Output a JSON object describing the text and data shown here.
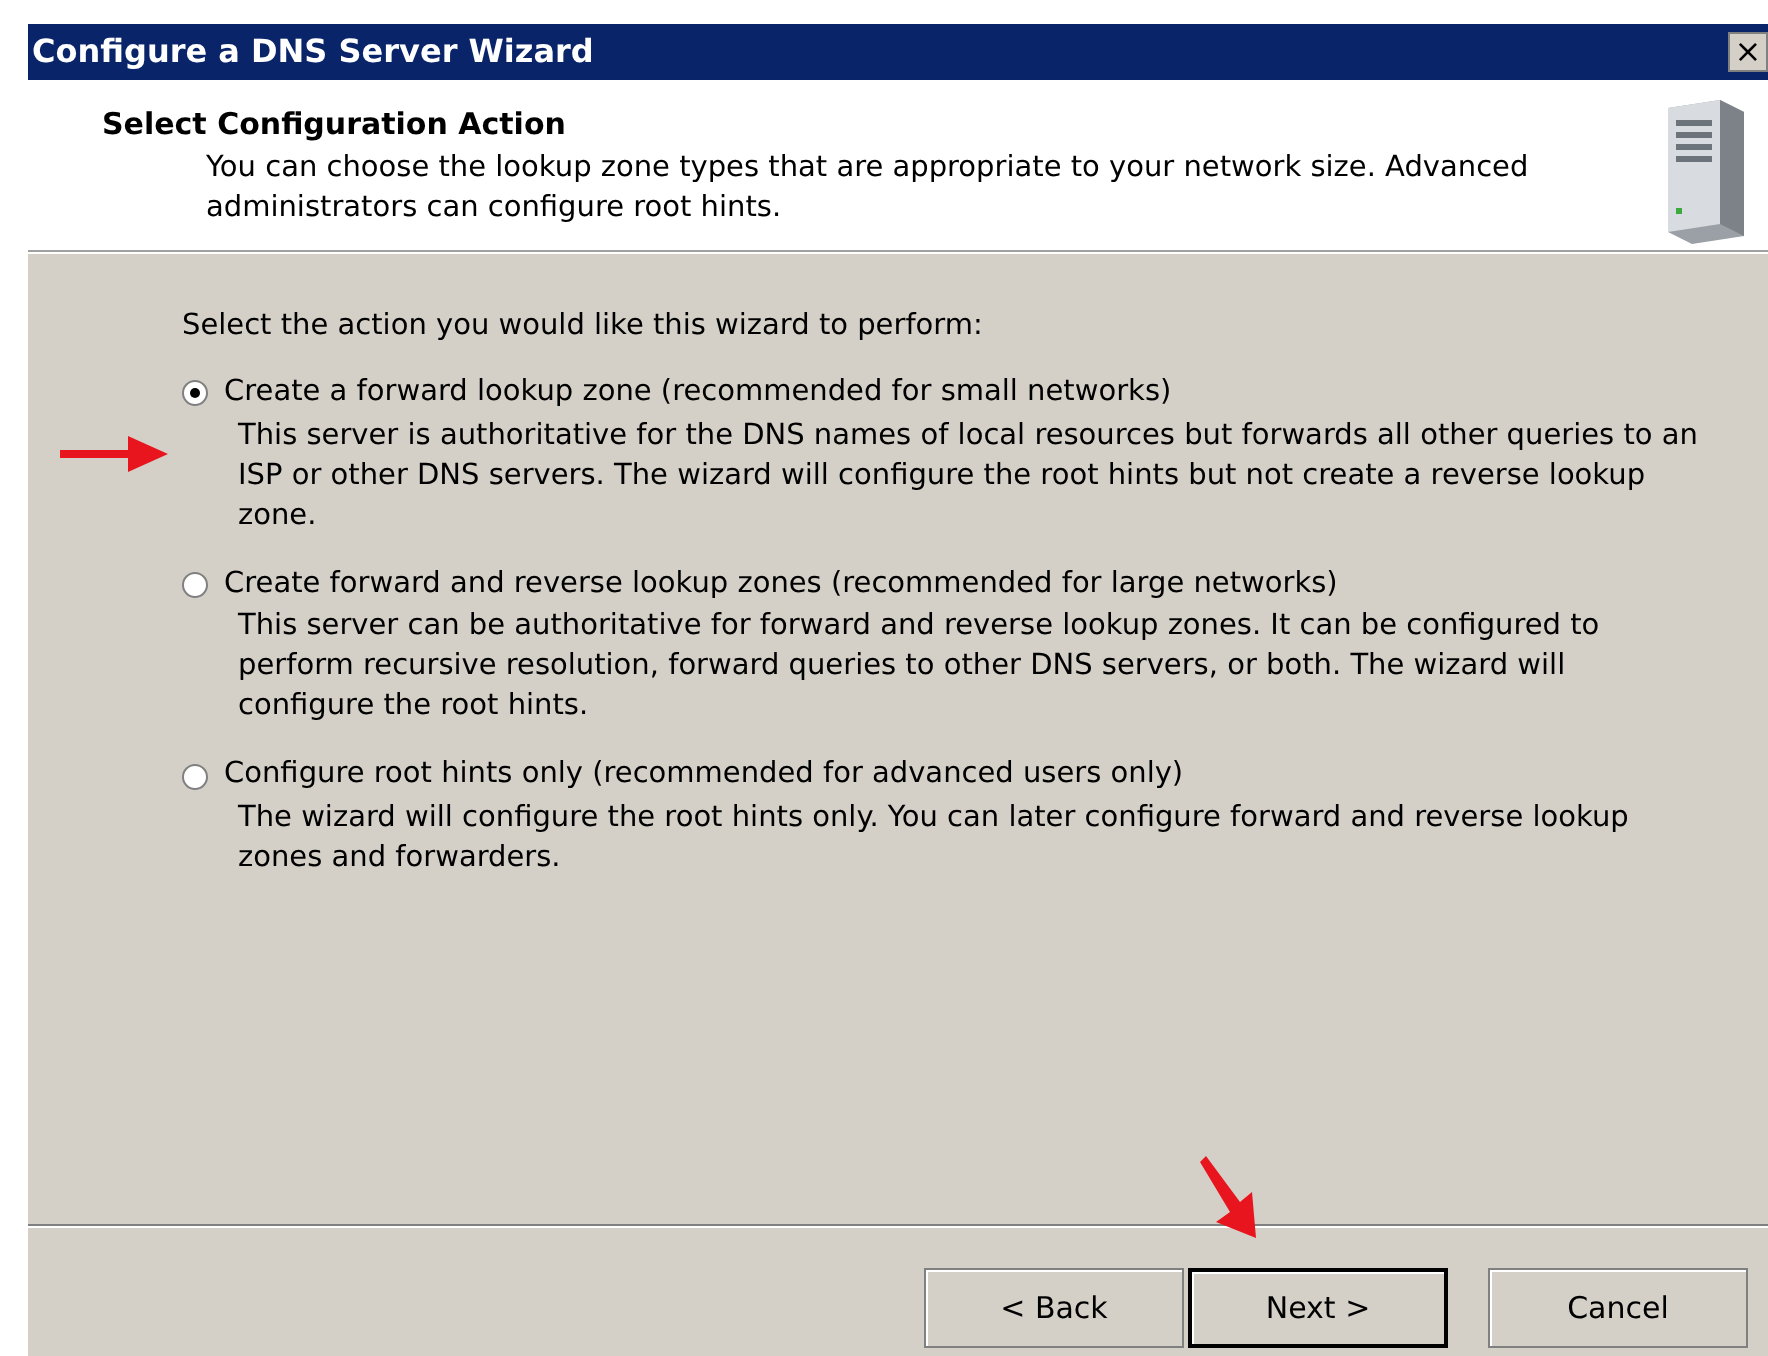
{
  "window": {
    "title": "Configure a DNS Server Wizard",
    "close": "×"
  },
  "header": {
    "title": "Select Configuration Action",
    "description": "You can choose the lookup zone types that are appropriate to your network size. Advanced administrators can configure root hints."
  },
  "prompt": "Select the action you would like this wizard to perform:",
  "options": [
    {
      "label": "Create a forward lookup zone (recommended for small networks)",
      "description": "This server is authoritative for the DNS names of local resources but forwards all other queries to an ISP or other DNS servers. The wizard will configure the root hints but not create a reverse lookup zone.",
      "selected": true
    },
    {
      "label": "Create forward and reverse lookup zones (recommended for large networks)",
      "description": "This server can be authoritative for forward and reverse lookup zones. It can be configured to perform recursive resolution, forward queries to other DNS servers, or both. The wizard will configure the root hints.",
      "selected": false
    },
    {
      "label": "Configure root hints only (recommended for advanced users only)",
      "description": "The wizard will configure the root hints only. You can later configure forward and reverse lookup zones and forwarders.",
      "selected": false
    }
  ],
  "buttons": [
    {
      "label": "< Back",
      "default": false
    },
    {
      "label": "Next >",
      "default": true
    },
    {
      "label": "Cancel",
      "default": false
    }
  ]
}
